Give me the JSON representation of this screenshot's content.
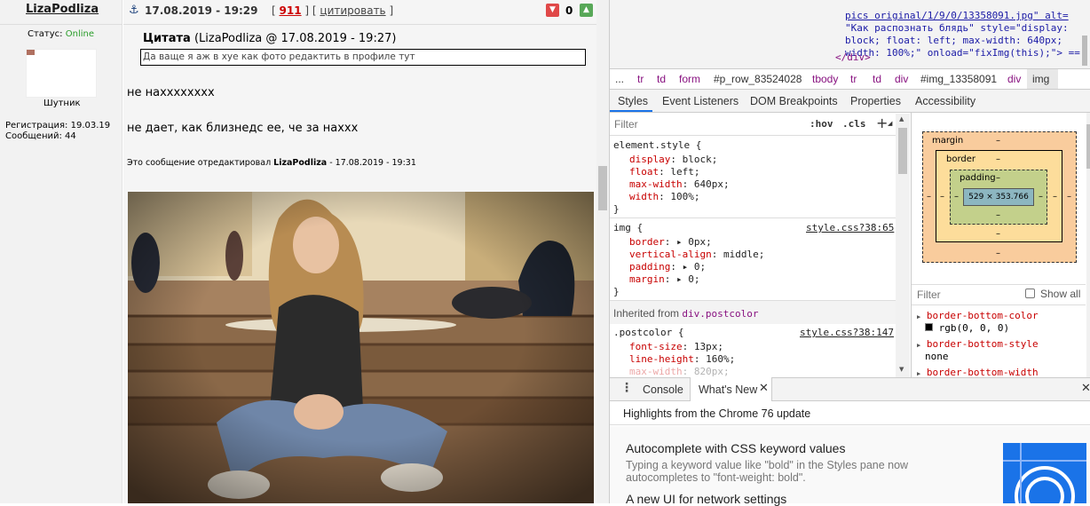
{
  "forum": {
    "username": "LizaPodliza",
    "status_label": "Статус:",
    "status_value": "Online",
    "user_title": "Шутник",
    "registration": "Регистрация: 19.03.19",
    "messages": "Сообщений: 44",
    "anchor_icon": "anchor-icon",
    "post_date": "17.08.2019 - 19:29",
    "bracket_open": "[",
    "post_number": "911",
    "bracket_mid": "] [",
    "quote_link": "цитировать",
    "bracket_close": "]",
    "downvote_icon": "thumbs-down-icon",
    "score": "0",
    "upvote_icon": "thumbs-up-icon",
    "quote_title": "Цитата",
    "quote_meta": "(LizaPodliza @ 17.08.2019 - 19:27)",
    "quote_text": "Да ваще я аж в хуе как фото редактить в профиле тут",
    "line1": "не нахххххххх",
    "line2": "не дает, как близнедс ее, че за нахxx",
    "edited_prefix": "Это сообщение отредактировал",
    "edited_user": "LizaPodliza",
    "edited_date": "- 17.08.2019 - 19:31"
  },
  "devtools": {
    "html_lines": [
      "pics original/1/9/0/13358091.jpg\" alt=",
      "\"Как распознать блядь\" style=\"display:",
      "block; float: left; max-width: 640px;",
      "width: 100%;\" onload=\"fixImg(this);\"> ==",
      "</div>"
    ],
    "breadcrumbs": [
      "...",
      "tr",
      "td",
      "form",
      "#p_row_83524028",
      "tbody",
      "tr",
      "td",
      "div",
      "#img_13358091",
      "div",
      "img"
    ],
    "panel_tabs": [
      "Styles",
      "Event Listeners",
      "DOM Breakpoints",
      "Properties",
      "Accessibility"
    ],
    "filter_placeholder": "Filter",
    "hov": ":hov",
    "cls": ".cls",
    "plus": "+",
    "element_style_selector": "element.style {",
    "element_style_rules": [
      {
        "prop": "display",
        "val": "block;"
      },
      {
        "prop": "float",
        "val": "left;"
      },
      {
        "prop": "max-width",
        "val": "640px;"
      },
      {
        "prop": "width",
        "val": "100%;"
      }
    ],
    "close_brace": "}",
    "img_selector": "img {",
    "img_source": "style.css?38:65",
    "img_rules": [
      {
        "prop": "border",
        "val": "▸ 0px;"
      },
      {
        "prop": "vertical-align",
        "val": "middle;"
      },
      {
        "prop": "padding",
        "val": "▸ 0;"
      },
      {
        "prop": "margin",
        "val": "▸ 0;"
      }
    ],
    "inherited_label": "Inherited from",
    "inherited_from": "div.postcolor",
    "postcolor_selector": ".postcolor {",
    "postcolor_source": "style.css?38:147",
    "postcolor_rules": [
      {
        "prop": "font-size",
        "val": "13px;"
      },
      {
        "prop": "line-height",
        "val": "160%;"
      },
      {
        "prop": "max-width",
        "val": "820px;"
      }
    ],
    "box_margin": "margin",
    "box_border": "border",
    "box_padding": "padding",
    "box_dash": "–",
    "box_size": "529 × 353.766",
    "computed_filter": "Filter",
    "show_all": "Show all",
    "computed": [
      {
        "prop": "border-bottom-color",
        "val": "rgb(0, 0, 0)"
      },
      {
        "prop": "border-bottom-style",
        "val": "none"
      },
      {
        "prop": "border-bottom-width",
        "val": ""
      }
    ],
    "drawer_tabs": [
      "Console",
      "What's New"
    ],
    "whatsnew_heading": "Highlights from the Chrome 76 update",
    "feature1_title": "Autocomplete with CSS keyword values",
    "feature1_desc": "Typing a keyword value like \"bold\" in the Styles pane now autocompletes to \"font-weight: bold\".",
    "feature2_title": "A new UI for network settings"
  },
  "colors": {
    "accent_link": "#1a0dab",
    "online": "#2a9d2a",
    "post_num": "#cc0000",
    "devtools_prop": "#c80000"
  }
}
